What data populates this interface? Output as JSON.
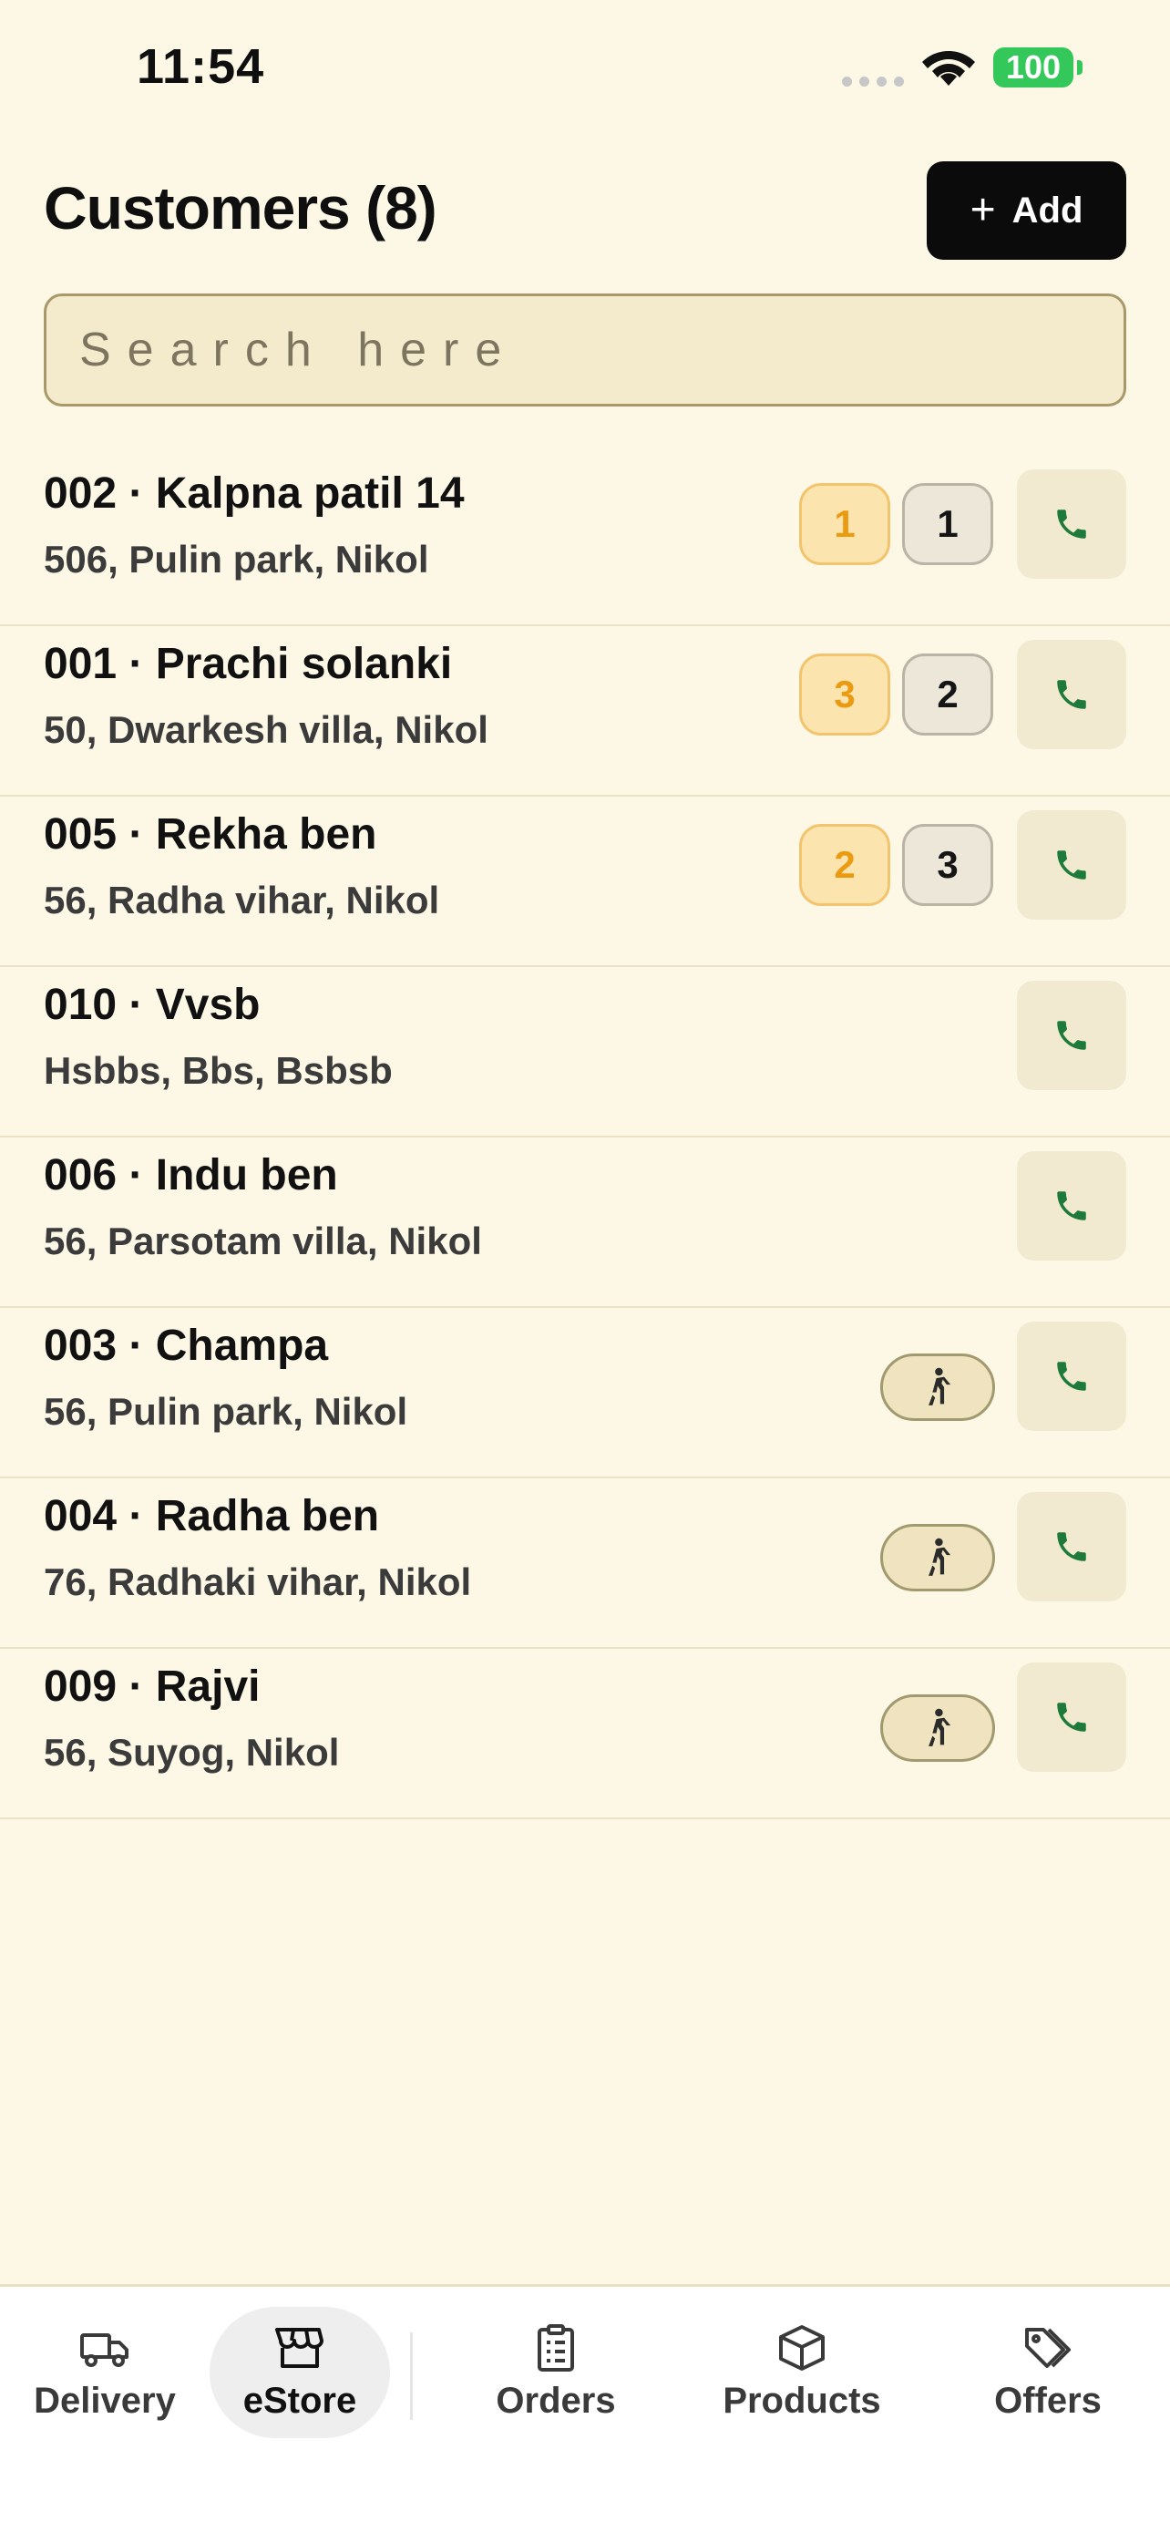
{
  "status_bar": {
    "time": "11:54",
    "battery": "100"
  },
  "header": {
    "title": "Customers (8)",
    "add_button": {
      "icon": "+",
      "label": "Add"
    }
  },
  "search": {
    "placeholder": "Search here"
  },
  "customers": [
    {
      "name": "002 · Kalpna patil 14",
      "address": "506, Pulin park, Nikol",
      "pending_count": "1",
      "count": "1"
    },
    {
      "name": "001 · Prachi solanki",
      "address": "50, Dwarkesh villa, Nikol",
      "pending_count": "3",
      "count": "2"
    },
    {
      "name": "005 · Rekha ben",
      "address": "56, Radha vihar, Nikol",
      "pending_count": "2",
      "count": "3"
    },
    {
      "name": "010 · Vvsb",
      "address": "Hsbbs, Bbs, Bsbsb"
    },
    {
      "name": "006 · Indu ben",
      "address": "56, Parsotam villa, Nikol"
    },
    {
      "name": "003 · Champa",
      "address": "56, Pulin park, Nikol",
      "walk_in": true
    },
    {
      "name": "004 · Radha ben",
      "address": "76, Radhaki vihar, Nikol",
      "walk_in": true
    },
    {
      "name": "009 · Rajvi",
      "address": "56, Suyog, Nikol",
      "walk_in": true
    }
  ],
  "bottom_nav": [
    {
      "label": "Delivery",
      "icon": "truck-icon"
    },
    {
      "label": "eStore",
      "icon": "store-icon",
      "active": true
    },
    {
      "label": "Orders",
      "icon": "clipboard-list-icon"
    },
    {
      "label": "Products",
      "icon": "box-icon"
    },
    {
      "label": "Offers",
      "icon": "tags-icon"
    }
  ],
  "colors": {
    "background": "#fdf7e6",
    "call_icon": "#1e7a3a",
    "pending_badge": "#ea9b12",
    "battery": "#34c759"
  }
}
